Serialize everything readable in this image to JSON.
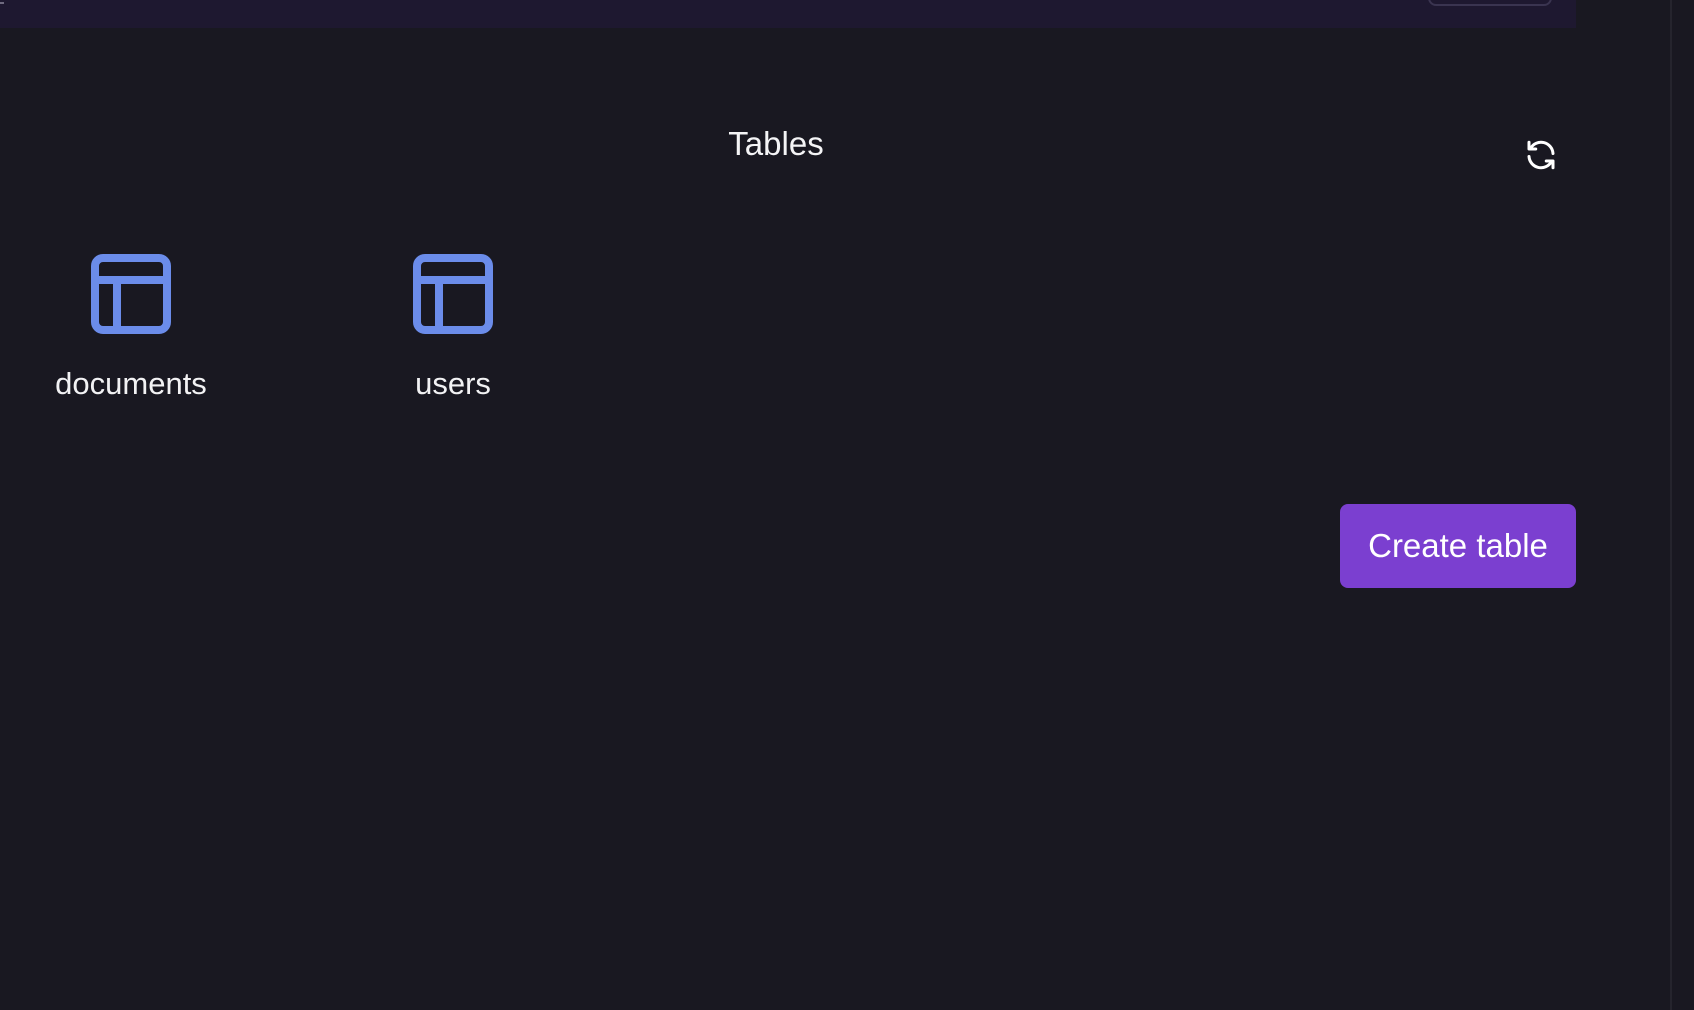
{
  "colors": {
    "background": "#191821",
    "top_strip": "#1e1830",
    "table_icon": "#6b8cea",
    "primary_button": "#7b3fd0",
    "text": "#ffffff"
  },
  "header": {
    "title": "Tables",
    "refresh_icon": "refresh-icon"
  },
  "tables": [
    {
      "name": "documents",
      "icon": "table-layout-icon"
    },
    {
      "name": "users",
      "icon": "table-layout-icon"
    }
  ],
  "actions": {
    "create_table_label": "Create table"
  }
}
